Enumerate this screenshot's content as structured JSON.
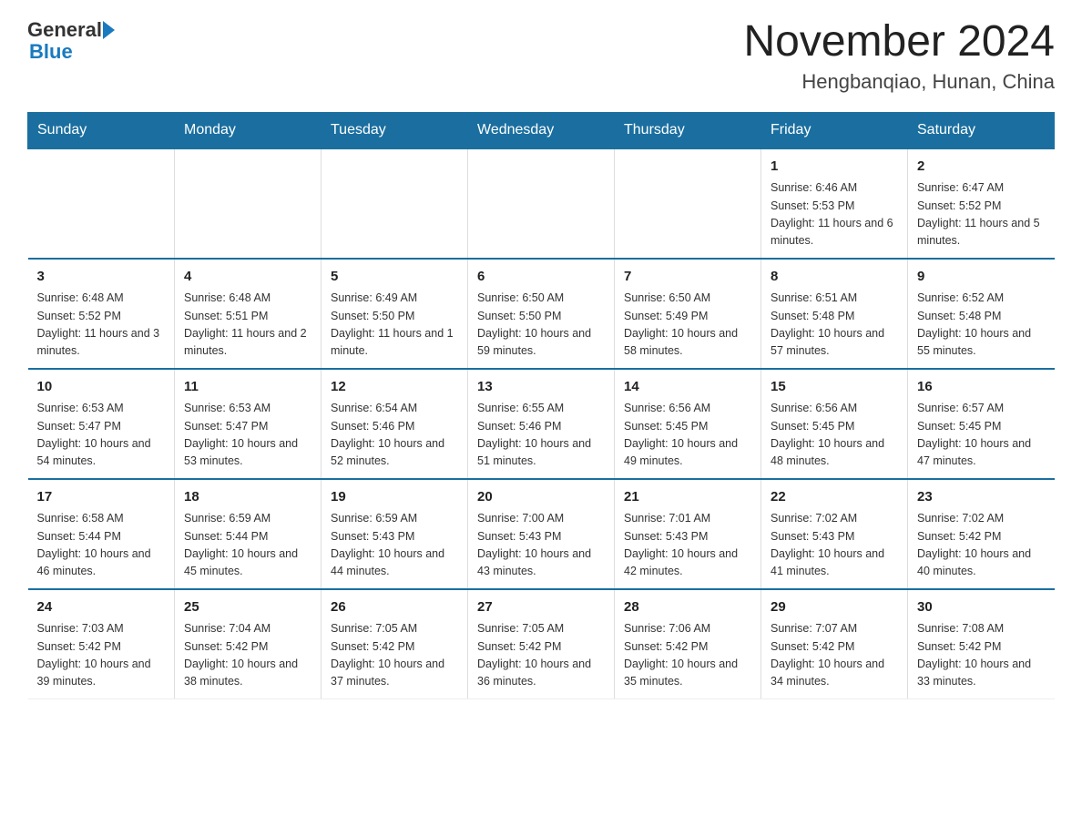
{
  "logo": {
    "general": "General",
    "blue": "Blue",
    "arrow": "▶"
  },
  "header": {
    "title": "November 2024",
    "subtitle": "Hengbanqiao, Hunan, China"
  },
  "weekdays": [
    "Sunday",
    "Monday",
    "Tuesday",
    "Wednesday",
    "Thursday",
    "Friday",
    "Saturday"
  ],
  "weeks": [
    [
      {
        "day": "",
        "info": ""
      },
      {
        "day": "",
        "info": ""
      },
      {
        "day": "",
        "info": ""
      },
      {
        "day": "",
        "info": ""
      },
      {
        "day": "",
        "info": ""
      },
      {
        "day": "1",
        "info": "Sunrise: 6:46 AM\nSunset: 5:53 PM\nDaylight: 11 hours and 6 minutes."
      },
      {
        "day": "2",
        "info": "Sunrise: 6:47 AM\nSunset: 5:52 PM\nDaylight: 11 hours and 5 minutes."
      }
    ],
    [
      {
        "day": "3",
        "info": "Sunrise: 6:48 AM\nSunset: 5:52 PM\nDaylight: 11 hours and 3 minutes."
      },
      {
        "day": "4",
        "info": "Sunrise: 6:48 AM\nSunset: 5:51 PM\nDaylight: 11 hours and 2 minutes."
      },
      {
        "day": "5",
        "info": "Sunrise: 6:49 AM\nSunset: 5:50 PM\nDaylight: 11 hours and 1 minute."
      },
      {
        "day": "6",
        "info": "Sunrise: 6:50 AM\nSunset: 5:50 PM\nDaylight: 10 hours and 59 minutes."
      },
      {
        "day": "7",
        "info": "Sunrise: 6:50 AM\nSunset: 5:49 PM\nDaylight: 10 hours and 58 minutes."
      },
      {
        "day": "8",
        "info": "Sunrise: 6:51 AM\nSunset: 5:48 PM\nDaylight: 10 hours and 57 minutes."
      },
      {
        "day": "9",
        "info": "Sunrise: 6:52 AM\nSunset: 5:48 PM\nDaylight: 10 hours and 55 minutes."
      }
    ],
    [
      {
        "day": "10",
        "info": "Sunrise: 6:53 AM\nSunset: 5:47 PM\nDaylight: 10 hours and 54 minutes."
      },
      {
        "day": "11",
        "info": "Sunrise: 6:53 AM\nSunset: 5:47 PM\nDaylight: 10 hours and 53 minutes."
      },
      {
        "day": "12",
        "info": "Sunrise: 6:54 AM\nSunset: 5:46 PM\nDaylight: 10 hours and 52 minutes."
      },
      {
        "day": "13",
        "info": "Sunrise: 6:55 AM\nSunset: 5:46 PM\nDaylight: 10 hours and 51 minutes."
      },
      {
        "day": "14",
        "info": "Sunrise: 6:56 AM\nSunset: 5:45 PM\nDaylight: 10 hours and 49 minutes."
      },
      {
        "day": "15",
        "info": "Sunrise: 6:56 AM\nSunset: 5:45 PM\nDaylight: 10 hours and 48 minutes."
      },
      {
        "day": "16",
        "info": "Sunrise: 6:57 AM\nSunset: 5:45 PM\nDaylight: 10 hours and 47 minutes."
      }
    ],
    [
      {
        "day": "17",
        "info": "Sunrise: 6:58 AM\nSunset: 5:44 PM\nDaylight: 10 hours and 46 minutes."
      },
      {
        "day": "18",
        "info": "Sunrise: 6:59 AM\nSunset: 5:44 PM\nDaylight: 10 hours and 45 minutes."
      },
      {
        "day": "19",
        "info": "Sunrise: 6:59 AM\nSunset: 5:43 PM\nDaylight: 10 hours and 44 minutes."
      },
      {
        "day": "20",
        "info": "Sunrise: 7:00 AM\nSunset: 5:43 PM\nDaylight: 10 hours and 43 minutes."
      },
      {
        "day": "21",
        "info": "Sunrise: 7:01 AM\nSunset: 5:43 PM\nDaylight: 10 hours and 42 minutes."
      },
      {
        "day": "22",
        "info": "Sunrise: 7:02 AM\nSunset: 5:43 PM\nDaylight: 10 hours and 41 minutes."
      },
      {
        "day": "23",
        "info": "Sunrise: 7:02 AM\nSunset: 5:42 PM\nDaylight: 10 hours and 40 minutes."
      }
    ],
    [
      {
        "day": "24",
        "info": "Sunrise: 7:03 AM\nSunset: 5:42 PM\nDaylight: 10 hours and 39 minutes."
      },
      {
        "day": "25",
        "info": "Sunrise: 7:04 AM\nSunset: 5:42 PM\nDaylight: 10 hours and 38 minutes."
      },
      {
        "day": "26",
        "info": "Sunrise: 7:05 AM\nSunset: 5:42 PM\nDaylight: 10 hours and 37 minutes."
      },
      {
        "day": "27",
        "info": "Sunrise: 7:05 AM\nSunset: 5:42 PM\nDaylight: 10 hours and 36 minutes."
      },
      {
        "day": "28",
        "info": "Sunrise: 7:06 AM\nSunset: 5:42 PM\nDaylight: 10 hours and 35 minutes."
      },
      {
        "day": "29",
        "info": "Sunrise: 7:07 AM\nSunset: 5:42 PM\nDaylight: 10 hours and 34 minutes."
      },
      {
        "day": "30",
        "info": "Sunrise: 7:08 AM\nSunset: 5:42 PM\nDaylight: 10 hours and 33 minutes."
      }
    ]
  ]
}
